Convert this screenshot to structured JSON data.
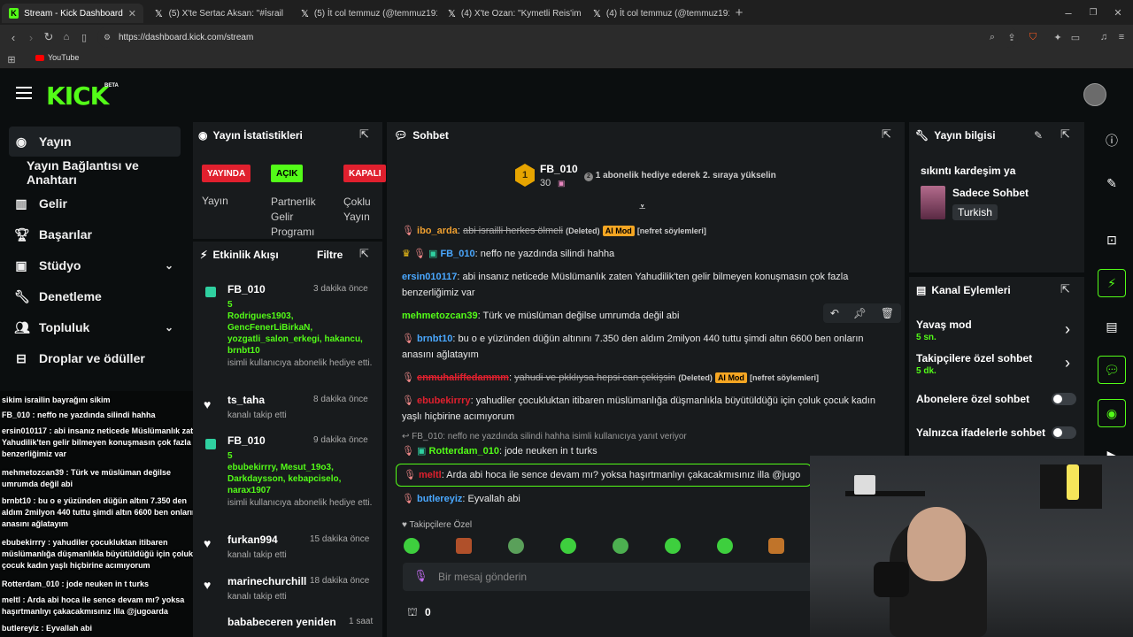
{
  "browser": {
    "tabs": [
      {
        "title": "Stream - Kick Dashboard",
        "active": true
      },
      {
        "title": "(5) X'te Sertac Aksan: \"#İsrail"
      },
      {
        "title": "(5) İt col temmuz (@temmuz1919) /"
      },
      {
        "title": "(4) X'te Ozan: \"Kymetli Reis'im bu ol"
      },
      {
        "title": "(4) İt col temmuz (@temmuz1919) /"
      }
    ],
    "url": "https://dashboard.kick.com/stream",
    "bookmark": "YouTube"
  },
  "kick": {
    "logo": "KICK",
    "beta": "BETA"
  },
  "sidebar": {
    "items": [
      {
        "label": "Yayın",
        "icon": "broadcast-icon",
        "active": true
      },
      {
        "label": "Yayın Bağlantısı ve Anahtarı",
        "icon": ""
      },
      {
        "label": "Gelir",
        "icon": "chart-icon"
      },
      {
        "label": "Başarılar",
        "icon": "trophy-icon"
      },
      {
        "label": "Stüdyo",
        "icon": "studio-icon"
      },
      {
        "label": "Denetleme",
        "icon": "wrench-icon"
      },
      {
        "label": "Topluluk",
        "icon": "users-icon"
      },
      {
        "label": "Droplar ve ödüller",
        "icon": "drops-icon"
      }
    ]
  },
  "stats": {
    "title": "Yayın İstatistikleri",
    "badges": [
      {
        "status": "YAYINDA",
        "label": "Yayın",
        "color": "#e0202e"
      },
      {
        "status": "AÇIK",
        "label": "Partnerlik Gelir Programı",
        "color": "#53fc18"
      },
      {
        "status": "KAPALI",
        "label": "Çoklu Yayın",
        "color": "#e0202e"
      }
    ]
  },
  "activity": {
    "title": "Etkinlik Akışı",
    "filter": "Filtre",
    "items": [
      {
        "name": "FB_010",
        "time": "3 dakika önce",
        "count": "5",
        "users": "Rodrigues1903, GencFenerLiBirkaN, yozgatli_salon_erkegi, hakancu, brnbt10",
        "desc": "isimli kullanıcıya abonelik hediye etti."
      },
      {
        "name": "ts_taha",
        "time": "8 dakika önce",
        "desc": "kanalı takip etti"
      },
      {
        "name": "FB_010",
        "time": "9 dakika önce",
        "count": "5",
        "users": "ebubekirrry, Mesut_19o3, Darkdaysson, kebapciselo, narax1907",
        "desc": "isimli kullanıcıya abonelik hediye etti."
      },
      {
        "name": "furkan994",
        "time": "15 dakika önce",
        "desc": "kanalı takip etti"
      },
      {
        "name": "marinechurchill",
        "time": "18 dakika önce",
        "desc": "kanalı takip etti"
      },
      {
        "name": "bababeceren yeniden",
        "time": "1 saat"
      }
    ]
  },
  "chat": {
    "title": "Sohbet",
    "top_gifter": {
      "name": "FB_010",
      "rank": "1",
      "count": "30",
      "hint": "1 abonelik hediye ederek 2. sıraya yükselin"
    },
    "messages": [
      {
        "user": "ibo_arda",
        "text": "abi israilli herkes ölmeli",
        "deleted": "(Deleted)",
        "mod": "AI Mod",
        "reason": "[nefret söylemleri]"
      },
      {
        "user": "FB_010",
        "text": "neffo ne yazdında silindi hahha"
      },
      {
        "user": "ersin010117",
        "text": "abi insanız neticede Müslümanlık zaten Yahudilik'ten gelir bilmeyen konuşmasın çok fazla benzerliğimiz var"
      },
      {
        "user": "mehmetozcan39",
        "text": "Türk ve müslüman değilse umrumda değil abi"
      },
      {
        "user": "brnbt10",
        "text": "bu o e yüzünden düğün altınını 7.350 den aldım 2milyon 440 tuttu şimdi altın 6600 ben onların anasını ağlatayım"
      },
      {
        "user": "enmuhaliffedammm",
        "text": "yahudi ve pkklıysa hepsi can çekişsin",
        "deleted": "(Deleted)",
        "mod": "AI Mod",
        "reason": "[nefret söylemleri]"
      },
      {
        "user": "ebubekirrry",
        "text": "yahudiler çocukluktan itibaren müslümanlığa düşmanlıkla büyütüldüğü için çoluk çocuk kadın yaşlı hiçbirine acımıyorum"
      },
      {
        "reply": "FB_010: neffo ne yazdında silindi hahha isimli kullanıcıya yanıt veriyor",
        "user": "Rotterdam_010",
        "text": "jode neuken in t turks"
      },
      {
        "user": "meltl",
        "text": "Arda abi hoca ile sence devam mı? yoksa haşırtmanlıyı çakacakmısınız illa @jugo"
      },
      {
        "user": "butlereyiz",
        "text": "Eyvallah abi"
      }
    ],
    "followers_label": "Takipçilere Özel",
    "input_placeholder": "Bir mesaj gönderin",
    "points": "0"
  },
  "stream_info": {
    "title": "Yayın bilgisi",
    "stream_title": "sıkıntı kardeşim ya",
    "category": "Sadece Sohbet",
    "language": "Turkish"
  },
  "channel_actions": {
    "title": "Kanal Eylemleri",
    "items": [
      {
        "label": "Yavaş mod",
        "value": "5 sn.",
        "type": "arrow"
      },
      {
        "label": "Takipçilere özel sohbet",
        "value": "5 dk.",
        "type": "arrow"
      },
      {
        "label": "Abonelere özel sohbet",
        "type": "toggle"
      },
      {
        "label": "Yalnızca ifadelerle sohbet",
        "type": "toggle"
      }
    ]
  },
  "overlay_chat": [
    "sikim israilin bayrağını sikim",
    "FB_010 : neffo ne yazdında silindi hahha",
    "ersin010117 : abi insanız neticede Müslümanlık zaten Yahudilik'ten gelir bilmeyen konuşmasın çok fazla benzerliğimiz var",
    "mehmetozcan39 : Türk ve müslüman değilse umrumda değil abi",
    "brnbt10 : bu o e yüzünden düğün altını 7.350 den aldım 2milyon 440 tuttu şimdi altın 6600 ben onların anasını ağlatayım",
    "ebubekirrry : yahudiler çocukluktan itibaren müslümanlığa düşmanlıkla büyütüldüğü için çoluk çocuk kadın yaşlı hiçbirine acımıyorum",
    "Rotterdam_010 : jode neuken in t turks",
    "meltl : Arda abi hoca ile sence devam mı? yoksa haşırtmanlıyı çakacakmısınız illa @jugoarda",
    "butlereyiz : Eyvallah abi"
  ],
  "colors": {
    "accent": "#53fc18",
    "live": "#e0202e",
    "panel": "#181b1d",
    "bg": "#0b0e0f"
  }
}
